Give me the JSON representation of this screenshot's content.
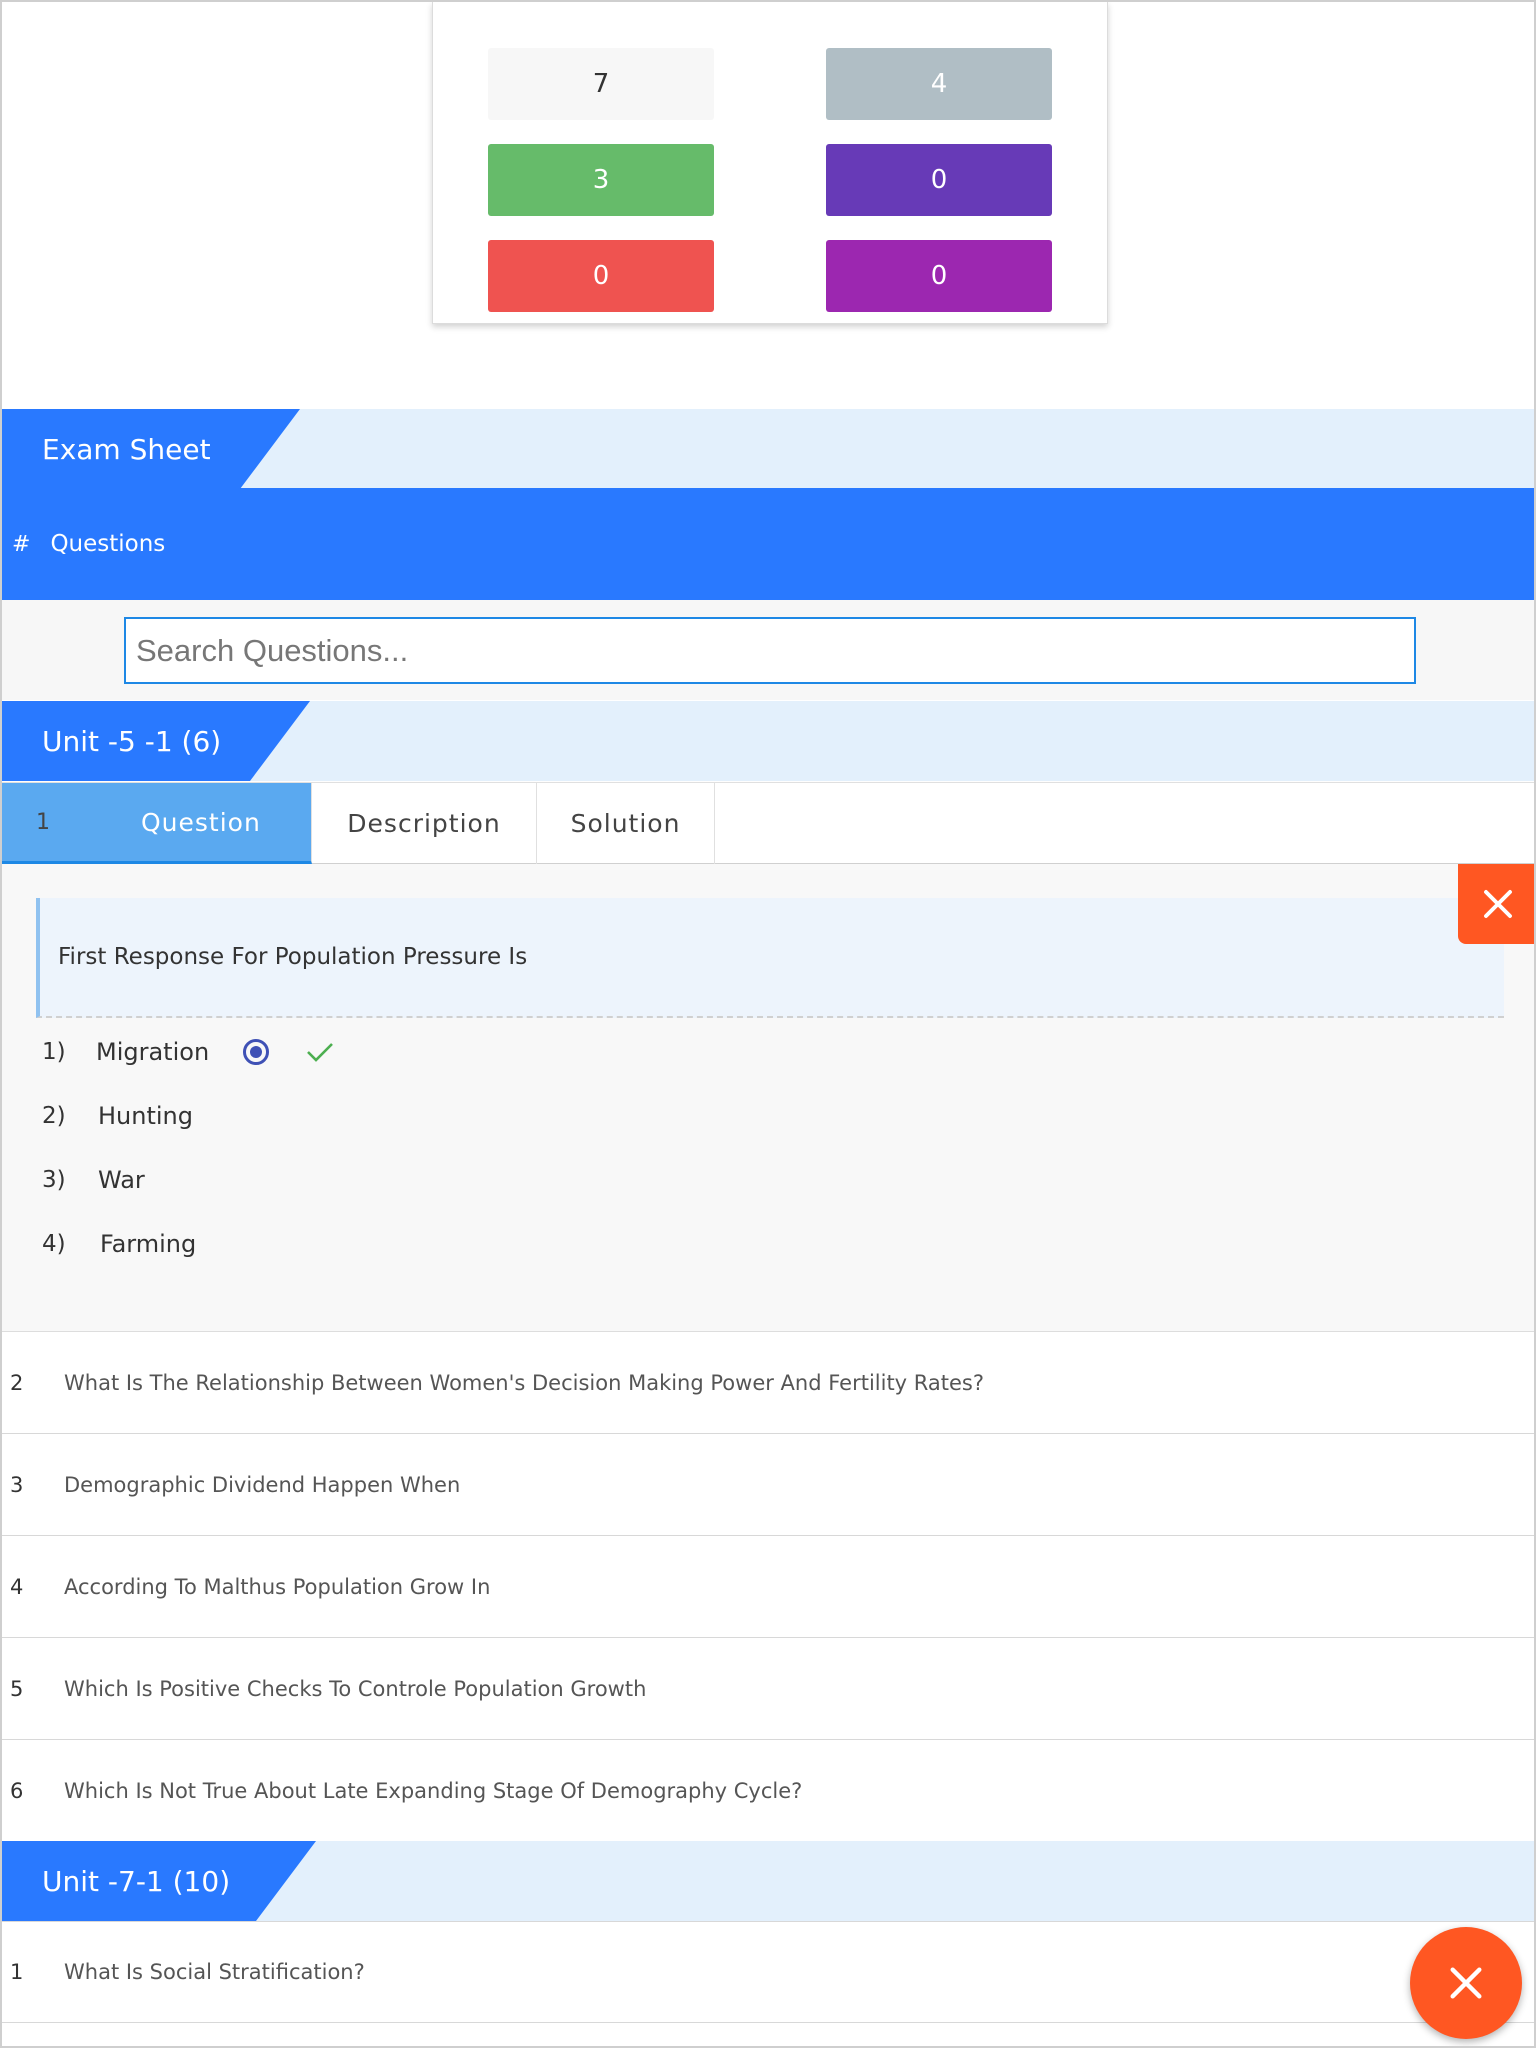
{
  "stats": [
    "7",
    "4",
    "3",
    "0",
    "0",
    "0"
  ],
  "colors": {
    "primary": "#2979ff",
    "accent": "#ff5722",
    "ribbon_bg": "#e3f0fc",
    "stat_gray": "#b0bec5",
    "stat_green": "#66bb6a",
    "stat_deep_purple": "#673ab7",
    "stat_red": "#ef5350",
    "stat_purple": "#9c27b0"
  },
  "exam_sheet": {
    "title": "Exam Sheet"
  },
  "questions_bar": {
    "hash": "#",
    "label": "Questions"
  },
  "search": {
    "placeholder": "Search Questions...",
    "value": ""
  },
  "units": [
    {
      "title": "Unit -5 -1 (6)",
      "tabs": {
        "number": "1",
        "question": "Question",
        "description": "Description",
        "solution": "Solution"
      },
      "active_question": {
        "text": "First Response For Population Pressure Is",
        "options": [
          {
            "num": "1)",
            "text": "Migration",
            "selected": true,
            "correct": true
          },
          {
            "num": "2)",
            "text": "Hunting"
          },
          {
            "num": "3)",
            "text": "War"
          },
          {
            "num": "4)",
            "text": "Farming"
          }
        ]
      },
      "questions": [
        {
          "num": "2",
          "text": "What Is The Relationship Between Women's Decision Making Power And Fertility Rates?"
        },
        {
          "num": "3",
          "text": "Demographic Dividend Happen When"
        },
        {
          "num": "4",
          "text": "According To Malthus Population Grow In"
        },
        {
          "num": "5",
          "text": "Which Is Positive Checks To Controle Population Growth"
        },
        {
          "num": "6",
          "text": "Which Is Not True About Late Expanding Stage Of Demography Cycle?"
        }
      ]
    },
    {
      "title": "Unit -7-1 (10)",
      "questions": [
        {
          "num": "1",
          "text": "What Is Social Stratification?"
        }
      ]
    }
  ],
  "icons": {
    "close": "close-icon",
    "radio": "radio-selected-icon",
    "check": "check-icon"
  }
}
